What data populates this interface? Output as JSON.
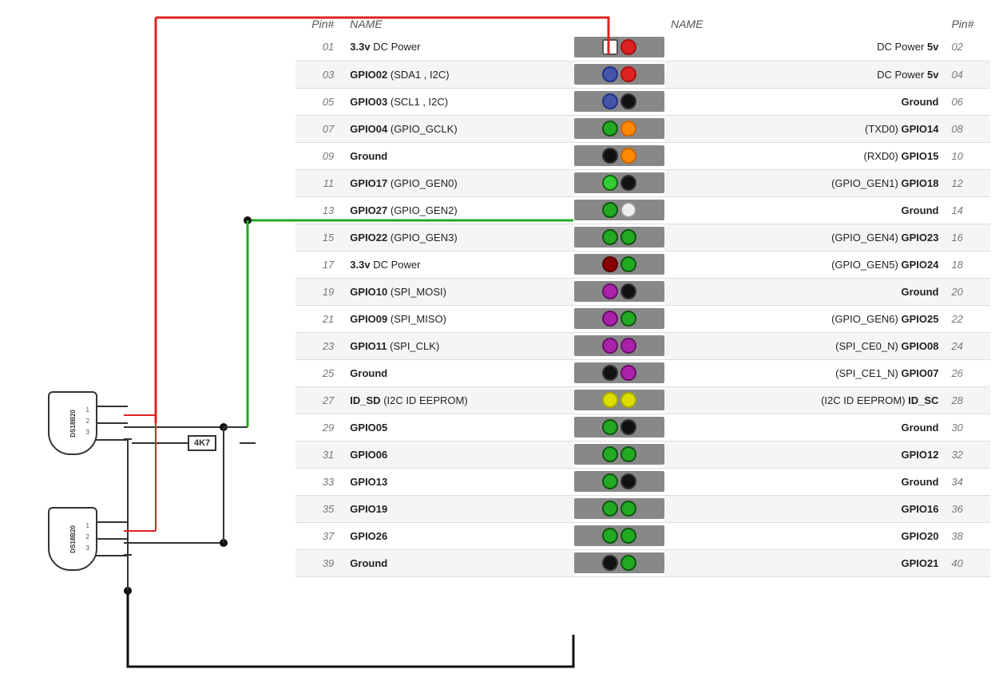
{
  "header": {
    "col_pin_left": "Pin#",
    "col_name_left": "NAME",
    "col_name_right": "NAME",
    "col_pin_right": "Pin#"
  },
  "rows": [
    {
      "pinL": "01",
      "nameL": "3.3v DC Power",
      "nameLBold": "3.3v",
      "nameR": "DC Power 5v",
      "nameRBold": "5v",
      "pinR": "02",
      "leftColor": "white-sq",
      "rightColor": "red"
    },
    {
      "pinL": "03",
      "nameL": "GPIO02 (SDA1 , I2C)",
      "nameLBold": "GPIO02",
      "nameR": "DC Power 5v",
      "nameRBold": "5v",
      "pinR": "04",
      "leftColor": "blue",
      "rightColor": "red"
    },
    {
      "pinL": "05",
      "nameL": "GPIO03 (SCL1 , I2C)",
      "nameLBold": "GPIO03",
      "nameR": "Ground",
      "nameRBold": "Ground",
      "pinR": "06",
      "leftColor": "blue",
      "rightColor": "black"
    },
    {
      "pinL": "07",
      "nameL": "GPIO04 (GPIO_GCLK)",
      "nameLBold": "GPIO04",
      "nameR": "(TXD0) GPIO14",
      "nameRBold": "GPIO14",
      "pinR": "08",
      "leftColor": "green",
      "rightColor": "orange"
    },
    {
      "pinL": "09",
      "nameL": "Ground",
      "nameLBold": "Ground",
      "nameR": "(RXD0) GPIO15",
      "nameRBold": "GPIO15",
      "pinR": "10",
      "leftColor": "black",
      "rightColor": "orange"
    },
    {
      "pinL": "11",
      "nameL": "GPIO17 (GPIO_GEN0)",
      "nameLBold": "GPIO17",
      "nameR": "(GPIO_GEN1) GPIO18",
      "nameRBold": "GPIO18",
      "pinR": "12",
      "leftColor": "green-lg",
      "rightColor": "black"
    },
    {
      "pinL": "13",
      "nameL": "GPIO27 (GPIO_GEN2)",
      "nameLBold": "GPIO27",
      "nameR": "Ground",
      "nameRBold": "Ground",
      "pinR": "14",
      "leftColor": "green",
      "rightColor": "white"
    },
    {
      "pinL": "15",
      "nameL": "GPIO22 (GPIO_GEN3)",
      "nameLBold": "GPIO22",
      "nameR": "(GPIO_GEN4) GPIO23",
      "nameRBold": "GPIO23",
      "pinR": "16",
      "leftColor": "green",
      "rightColor": "green"
    },
    {
      "pinL": "17",
      "nameL": "3.3v DC Power",
      "nameLBold": "3.3v",
      "nameR": "(GPIO_GEN5) GPIO24",
      "nameRBold": "GPIO24",
      "pinR": "18",
      "leftColor": "darkred",
      "rightColor": "green"
    },
    {
      "pinL": "19",
      "nameL": "GPIO10 (SPI_MOSI)",
      "nameLBold": "GPIO10",
      "nameR": "Ground",
      "nameRBold": "Ground",
      "pinR": "20",
      "leftColor": "purple",
      "rightColor": "black"
    },
    {
      "pinL": "21",
      "nameL": "GPIO09 (SPI_MISO)",
      "nameLBold": "GPIO09",
      "nameR": "(GPIO_GEN6) GPIO25",
      "nameRBold": "GPIO25",
      "pinR": "22",
      "leftColor": "purple",
      "rightColor": "green"
    },
    {
      "pinL": "23",
      "nameL": "GPIO11 (SPI_CLK)",
      "nameLBold": "GPIO11",
      "nameR": "(SPI_CE0_N) GPIO08",
      "nameRBold": "GPIO08",
      "pinR": "24",
      "leftColor": "purple",
      "rightColor": "purple"
    },
    {
      "pinL": "25",
      "nameL": "Ground",
      "nameLBold": "Ground",
      "nameR": "(SPI_CE1_N) GPIO07",
      "nameRBold": "GPIO07",
      "pinR": "26",
      "leftColor": "black",
      "rightColor": "purple"
    },
    {
      "pinL": "27",
      "nameL": "ID_SD (I2C ID EEPROM)",
      "nameLBold": "ID_SD",
      "nameR": "(I2C ID EEPROM) ID_SC",
      "nameRBold": "ID_SC",
      "pinR": "28",
      "leftColor": "yellow",
      "rightColor": "yellow"
    },
    {
      "pinL": "29",
      "nameL": "GPIO05",
      "nameLBold": "GPIO05",
      "nameR": "Ground",
      "nameRBold": "Ground",
      "pinR": "30",
      "leftColor": "green",
      "rightColor": "black"
    },
    {
      "pinL": "31",
      "nameL": "GPIO06",
      "nameLBold": "GPIO06",
      "nameR": "GPIO12",
      "nameRBold": "GPIO12",
      "pinR": "32",
      "leftColor": "green",
      "rightColor": "green"
    },
    {
      "pinL": "33",
      "nameL": "GPIO13",
      "nameLBold": "GPIO13",
      "nameR": "Ground",
      "nameRBold": "Ground",
      "pinR": "34",
      "leftColor": "green",
      "rightColor": "black"
    },
    {
      "pinL": "35",
      "nameL": "GPIO19",
      "nameLBold": "GPIO19",
      "nameR": "GPIO16",
      "nameRBold": "GPIO16",
      "pinR": "36",
      "leftColor": "green",
      "rightColor": "green"
    },
    {
      "pinL": "37",
      "nameL": "GPIO26",
      "nameLBold": "GPIO26",
      "nameR": "GPIO20",
      "nameRBold": "GPIO20",
      "pinR": "38",
      "leftColor": "green",
      "rightColor": "green"
    },
    {
      "pinL": "39",
      "nameL": "Ground",
      "nameLBold": "Ground",
      "nameR": "GPIO21",
      "nameRBold": "GPIO21",
      "pinR": "40",
      "leftColor": "black-lg",
      "rightColor": "green"
    }
  ],
  "sensors": [
    {
      "label": "DS18B20",
      "pins": "1 2 3"
    },
    {
      "label": "DS18B20",
      "pins": "1 2 3"
    }
  ],
  "resistor": "4K7",
  "colors": {
    "red": "#dd2222",
    "orange": "#ff8800",
    "yellow": "#dddd00",
    "green": "#22aa22",
    "blue": "#4455aa",
    "purple": "#aa22aa",
    "black": "#111111",
    "white": "#ffffff",
    "darkred": "#8b0000",
    "connector_bg": "#888888"
  }
}
